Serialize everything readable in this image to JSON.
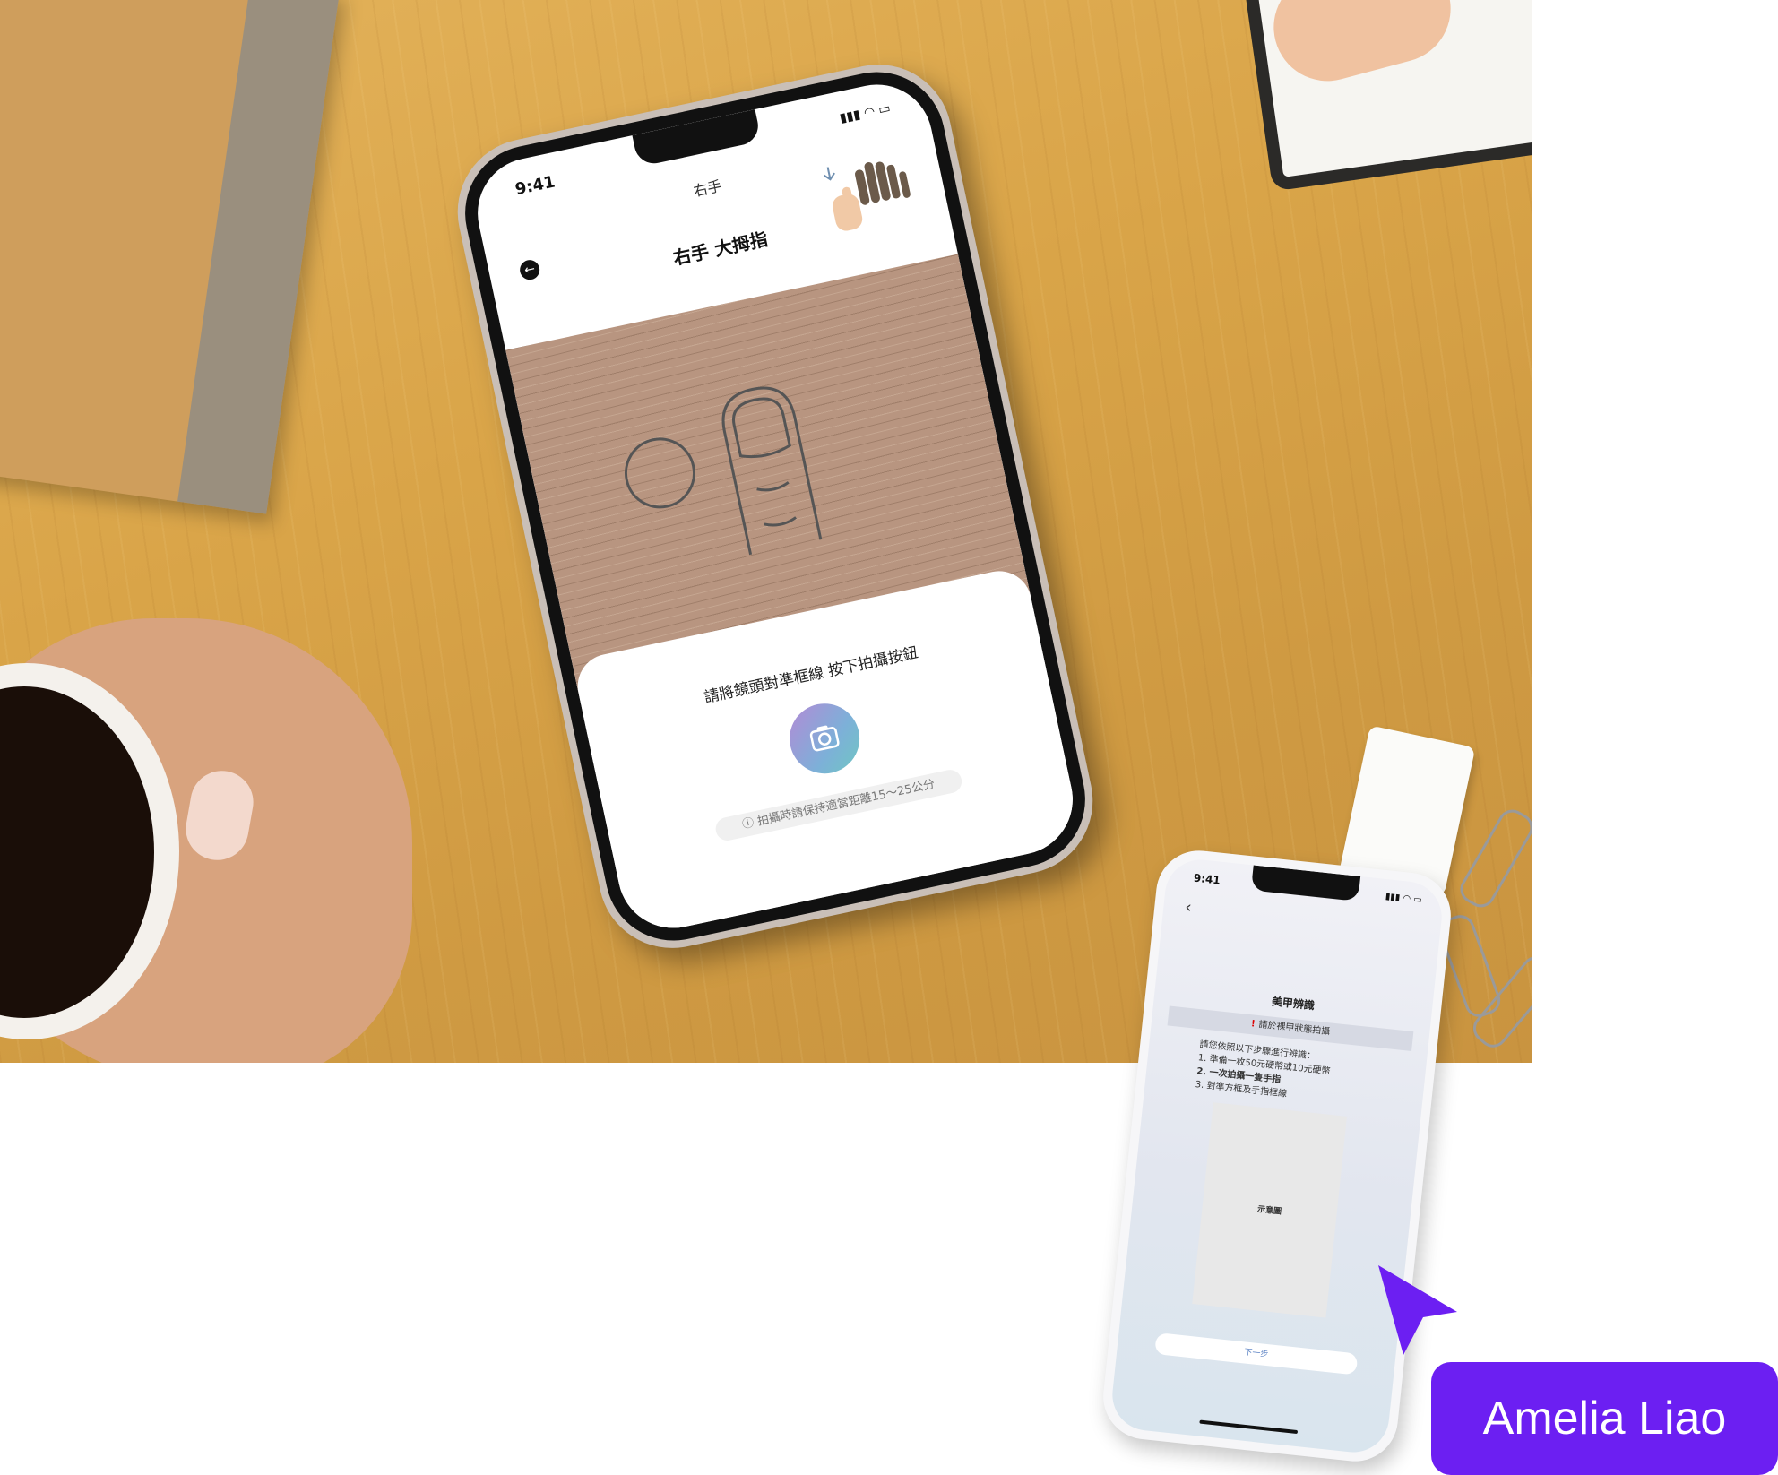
{
  "main_phone": {
    "status_time": "9:41",
    "nav_title": "右手",
    "back_icon": "back-arrow-icon",
    "screen_title": "右手 大拇指",
    "instruction": "請將鏡頭對準框線 按下拍攝按鈕",
    "shutter_icon": "camera-icon",
    "distance_hint": "ⓘ 拍攝時請保持適當距離15～25公分"
  },
  "second_phone": {
    "status_time": "9:41",
    "back_icon": "chevron-left-icon",
    "title": "美甲辨識",
    "warning": "請於裸甲狀態拍攝",
    "intro": "請您依照以下步驟進行辨識：",
    "steps": [
      "1. 準備一枚50元硬幣或10元硬幣",
      "2. 一次拍攝一隻手指",
      "3. 對準方框及手指框線"
    ],
    "example_label": "示意圖",
    "next_button": "下一步"
  },
  "cursor": {
    "icon": "pointer-cursor-icon",
    "color": "#6c1ff2"
  },
  "name_tag": {
    "label": "Amelia Liao",
    "color": "#6c1ff2"
  }
}
